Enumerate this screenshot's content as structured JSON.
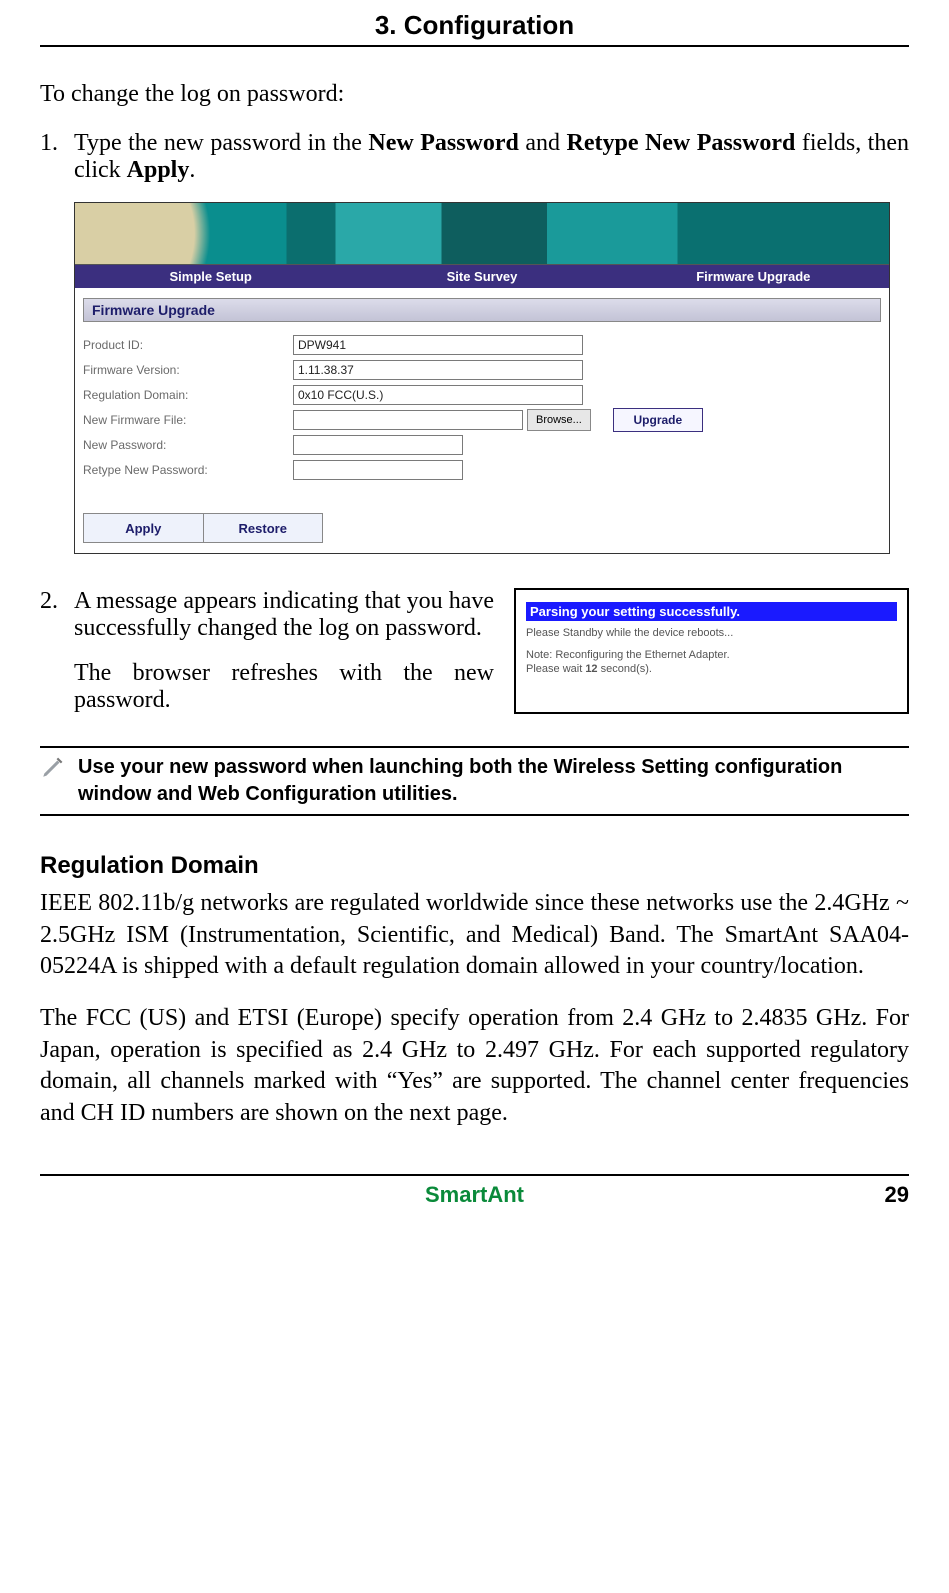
{
  "chapter_title": "3. Configuration",
  "intro": "To change the log on password:",
  "step1": {
    "num": "1.",
    "pre": "Type the new password in the ",
    "b1": "New Password",
    "mid": " and ",
    "b2": "Retype New Password",
    "post1": " fields, then click ",
    "b3": "Apply",
    "post2": "."
  },
  "fw": {
    "tabs": {
      "simple": "Simple Setup",
      "survey": "Site Survey",
      "upgrade": "Firmware Upgrade"
    },
    "section": "Firmware Upgrade",
    "labels": {
      "product_id": "Product ID:",
      "fw_version": "Firmware Version:",
      "reg_domain": "Regulation Domain:",
      "new_fw": "New Firmware File:",
      "new_pw": "New Password:",
      "retype_pw": "Retype New Password:"
    },
    "values": {
      "product_id": "DPW941",
      "fw_version": "1.11.38.37",
      "reg_domain": "0x10 FCC(U.S.)",
      "new_fw": "",
      "new_pw": "",
      "retype_pw": ""
    },
    "browse": "Browse...",
    "upgrade": "Upgrade",
    "apply": "Apply",
    "restore": "Restore"
  },
  "step2": {
    "num": "2.",
    "p1": "A message appears indicating that you have successfully changed the log on password.",
    "p2": "The browser refreshes with the new password."
  },
  "msg": {
    "title": "Parsing your setting successfully.",
    "l1": "Please Standby while the device reboots...",
    "l2a": "Note: Reconfiguring the Ethernet Adapter.",
    "l2b_pre": "Please wait ",
    "l2b_bold": "12",
    "l2b_post": " second(s)."
  },
  "note": "Use your new password when launching both the Wireless Setting configuration window and Web Configuration utilities.",
  "reg": {
    "heading": "Regulation Domain",
    "p1": "IEEE 802.11b/g networks are regulated worldwide since these networks use the 2.4GHz ~ 2.5GHz ISM (Instrumentation, Scientific, and Medical) Band. The SmartAnt SAA04-05224A is shipped with a default regulation domain allowed in your country/location.",
    "p2": "The FCC (US) and ETSI (Europe) specify operation from 2.4 GHz to 2.4835 GHz. For Japan, operation is specified as 2.4 GHz to 2.497 GHz. For each supported regulatory domain, all channels marked with “Yes” are supported. The channel center frequencies and CH ID numbers are shown on the next page."
  },
  "footer": {
    "brand": "SmartAnt",
    "page": "29"
  }
}
